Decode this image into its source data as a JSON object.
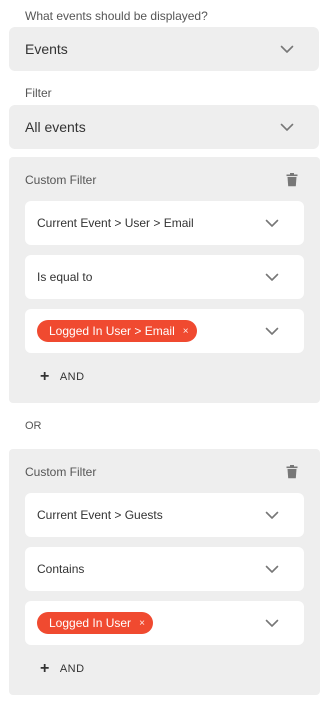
{
  "display_question": "What events should be displayed?",
  "events_select": {
    "value": "Events"
  },
  "filter_label": "Filter",
  "filter_select": {
    "value": "All events"
  },
  "or_label": "OR",
  "custom_filters": [
    {
      "title": "Custom Filter",
      "field": "Current Event > User > Email",
      "operator": "Is equal to",
      "value_chip": "Logged In User > Email",
      "chip_remove": "×",
      "add_and": "AND"
    },
    {
      "title": "Custom Filter",
      "field": "Current Event > Guests",
      "operator": "Contains",
      "value_chip": "Logged In User",
      "chip_remove": "×",
      "add_and": "AND"
    }
  ],
  "colors": {
    "chip_bg": "#f04a30",
    "panel_bg": "#eeeeee",
    "field_bg": "#ffffff"
  },
  "icons": {
    "dropdown": "chevron-down-icon",
    "delete": "trash-icon",
    "add": "plus-icon",
    "remove": "close-icon"
  }
}
